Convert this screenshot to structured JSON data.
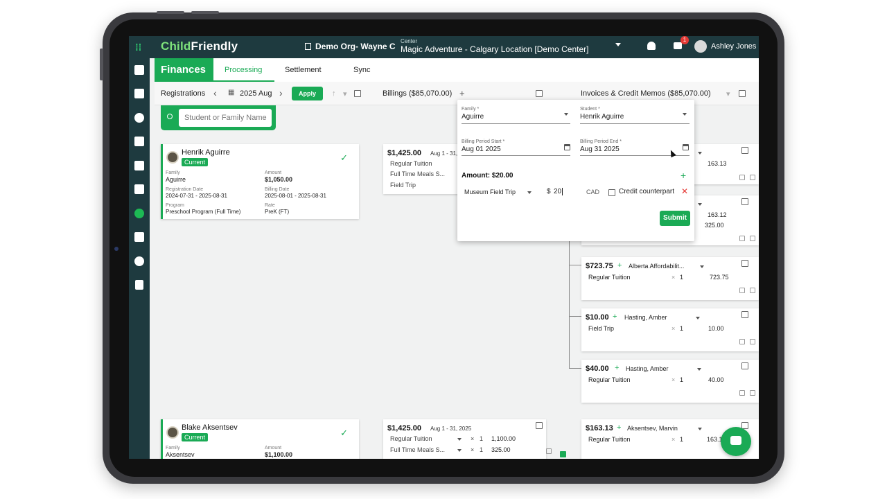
{
  "topbar": {
    "logo_part1": "Child",
    "logo_part2": "Friendly",
    "org": "Demo Org- Wayne C",
    "center_label": "Center",
    "center_value": "Magic Adventure - Calgary Location [Demo Center]",
    "notification_count": "1",
    "user_name": "Ashley Jones"
  },
  "nav": {
    "section": "Finances",
    "tabs": [
      "Processing",
      "Settlement",
      "Sync"
    ]
  },
  "toolbar": {
    "registrations": "Registrations",
    "period": "2025 Aug",
    "apply": "Apply",
    "billings": "Billings ($85,070.00)",
    "invoices": "Invoices & Credit Memos ($85,070.00)"
  },
  "search": {
    "placeholder": "Student or Family Name"
  },
  "registrations": [
    {
      "name": "Henrik Aguirre",
      "status": "Current",
      "family_label": "Family",
      "family": "Aguirre",
      "amount_label": "Amount",
      "amount": "$1,050.00",
      "reg_date_label": "Registration Date",
      "reg_date": "2024-07-31 - 2025-08-31",
      "billing_date_label": "Billing Date",
      "billing_date": "2025-08-01 - 2025-08-31",
      "program_label": "Program",
      "program": "Preschool Program (Full Time)",
      "rate_label": "Rate",
      "rate": "PreK (FT)"
    },
    {
      "name": "Blake Aksentsev",
      "status": "Current",
      "family_label": "Family",
      "family": "Aksentsev",
      "amount_label": "Amount",
      "amount": "$1,100.00"
    }
  ],
  "billings": [
    {
      "amount": "$1,425.00",
      "dates": "Aug 1 - 31,",
      "lines": [
        "Regular Tuition",
        "Full Time Meals S...",
        "Field Trip"
      ]
    },
    {
      "amount": "$1,425.00",
      "dates": "Aug 1 - 31, 2025",
      "lines": [
        {
          "name": "Regular Tuition",
          "qty": "1",
          "price": "1,100.00"
        },
        {
          "name": "Full Time Meals S...",
          "qty": "1",
          "price": "325.00"
        }
      ]
    }
  ],
  "invoices": [
    {
      "value_a": "163.13"
    },
    {
      "value_a": "163.12",
      "value_b": "325.00"
    },
    {
      "amount": "$723.75",
      "who": "Alberta Affordabilit...",
      "item": "Regular Tuition",
      "qty": "1",
      "price": "723.75"
    },
    {
      "amount": "$10.00",
      "who": "Hasting, Amber",
      "item": "Field Trip",
      "qty": "1",
      "price": "10.00"
    },
    {
      "amount": "$40.00",
      "who": "Hasting, Amber",
      "item": "Regular Tuition",
      "qty": "1",
      "price": "40.00"
    },
    {
      "amount": "$163.13",
      "who": "Aksentsev, Marvin",
      "item": "Regular Tuition",
      "qty": "1",
      "price": "163.1"
    }
  ],
  "popup": {
    "family_label": "Family *",
    "family": "Aguirre",
    "student_label": "Student *",
    "student": "Henrik Aguirre",
    "start_label": "Billing Period Start *",
    "start": "Aug 01 2025",
    "end_label": "Billing Period End *",
    "end": "Aug 31 2025",
    "amount": "Amount: $20.00",
    "item": "Museum Field Trip",
    "currency_symbol": "$",
    "value": "20",
    "currency": "CAD",
    "credit_label": "Credit counterpart",
    "submit": "Submit"
  },
  "icons": {
    "qty_x": "×",
    "plus": "+",
    "check": "✓",
    "close": "✕",
    "prev": "‹",
    "next": "›",
    "up": "↑"
  },
  "colors": {
    "brand_green": "#1aaa55",
    "topbar": "#1e3a3f",
    "danger": "#e53935"
  }
}
